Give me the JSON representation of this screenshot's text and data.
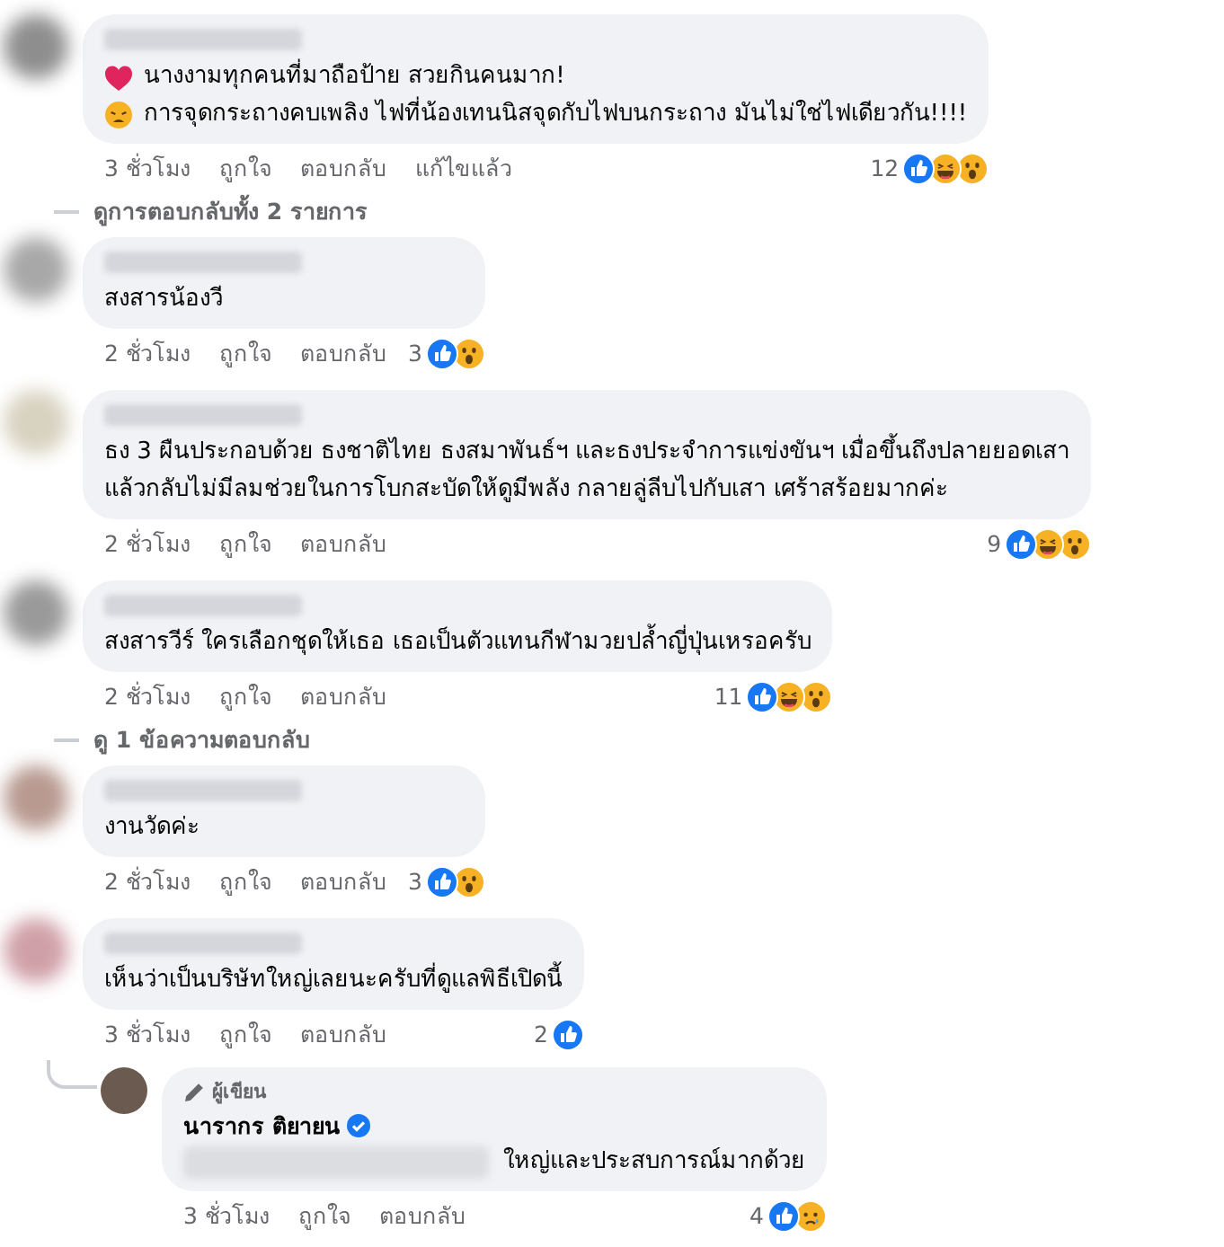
{
  "comments": [
    {
      "lines": [
        {
          "kind": "heart",
          "text": "นางงามทุกคนที่มาถือป้าย สวยกินคนมาก!"
        },
        {
          "kind": "face",
          "text": "การจุดกระถางคบเพลิง ไฟที่น้องเทนนิสจุดกับไฟบนกระถาง มันไม่ใช่ไฟเดียวกัน!!!!"
        }
      ],
      "time": "3 ชั่วโมง",
      "actions": [
        "ถูกใจ",
        "ตอบกลับ"
      ],
      "edited": "แก้ไขแล้ว",
      "reaction_count": "12",
      "reactions": [
        {
          "kind": "like"
        },
        {
          "kind": "haha"
        },
        {
          "kind": "wow"
        }
      ],
      "view_replies": "ดูการตอบกลับทั้ง 2 รายการ"
    },
    {
      "lines": [
        {
          "text": "สงสารน้องวี"
        }
      ],
      "time": "2 ชั่วโมง",
      "actions": [
        "ถูกใจ",
        "ตอบกลับ"
      ],
      "reaction_count": "3",
      "reactions": [
        {
          "kind": "like"
        },
        {
          "kind": "wow"
        }
      ]
    },
    {
      "lines": [
        {
          "text": "ธง 3 ผืนประกอบด้วย ธงชาติไทย ธงสมาพันธ์ฯ และธงประจำการแข่งขันฯ เมื่อขึ้นถึงปลายยอดเสา"
        },
        {
          "text": "แล้วกลับไม่มีลมช่วยในการโบกสะบัดให้ดูมีพลัง กลายลู่ลีบไปกับเสา เศร้าสร้อยมากค่ะ"
        }
      ],
      "time": "2 ชั่วโมง",
      "actions": [
        "ถูกใจ",
        "ตอบกลับ"
      ],
      "reaction_count": "9",
      "reactions": [
        {
          "kind": "like"
        },
        {
          "kind": "haha"
        },
        {
          "kind": "wow"
        }
      ]
    },
    {
      "lines": [
        {
          "text": "สงสารวีร์ ใครเลือกชุดให้เธอ เธอเป็นตัวแทนกีฬามวยปล้ำญี่ปุ่นเหรอครับ"
        }
      ],
      "time": "2 ชั่วโมง",
      "actions": [
        "ถูกใจ",
        "ตอบกลับ"
      ],
      "reaction_count": "11",
      "reactions": [
        {
          "kind": "like"
        },
        {
          "kind": "haha"
        },
        {
          "kind": "wow"
        }
      ],
      "view_replies": "ดู 1 ข้อความตอบกลับ"
    },
    {
      "lines": [
        {
          "text": "งานวัดค่ะ"
        }
      ],
      "time": "2 ชั่วโมง",
      "actions": [
        "ถูกใจ",
        "ตอบกลับ"
      ],
      "reaction_count": "3",
      "reactions": [
        {
          "kind": "like"
        },
        {
          "kind": "wow"
        }
      ]
    },
    {
      "lines": [
        {
          "text": "เห็นว่าเป็นบริษัทใหญ่เลยนะครับที่ดูแลพิธีเปิดนี้"
        }
      ],
      "time": "3 ชั่วโมง",
      "actions": [
        "ถูกใจ",
        "ตอบกลับ"
      ],
      "reaction_count": "2",
      "reactions": [
        {
          "kind": "like"
        }
      ],
      "reply": {
        "author_badge": "ผู้เขียน",
        "author": "นารากร ติยายน",
        "verified": true,
        "hidden_prefix": true,
        "text": "ใหญ่และประสบการณ์มากด้วย",
        "time": "3 ชั่วโมง",
        "actions": [
          "ถูกใจ",
          "ตอบกลับ"
        ],
        "reaction_count": "4",
        "reactions": [
          {
            "kind": "like"
          },
          {
            "kind": "sad"
          }
        ]
      }
    }
  ]
}
